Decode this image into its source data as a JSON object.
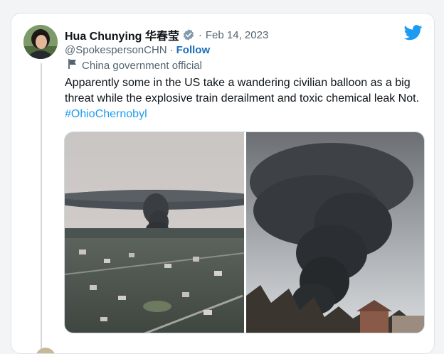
{
  "tweet": {
    "author_name": "Hua Chunying 华春莹",
    "date": "Feb 14, 2023",
    "handle": "@SpokespersonCHN",
    "separator": "·",
    "follow_label": "Follow",
    "label": "China government official",
    "text": "Apparently some in the US take a wandering civilian balloon as a big threat while the explosive train derailment and toxic chemical leak Not. ",
    "hashtag": "#OhioChernobyl"
  },
  "icons": {
    "brand": "twitter-bird-icon",
    "verified": "verified-badge-icon",
    "government": "flag-icon"
  },
  "colors": {
    "twitter_blue": "#1d9bf0",
    "follow": "#1d6fb8",
    "text": "#0f1419",
    "muted": "#536471",
    "verified_badge": "#829aab"
  }
}
